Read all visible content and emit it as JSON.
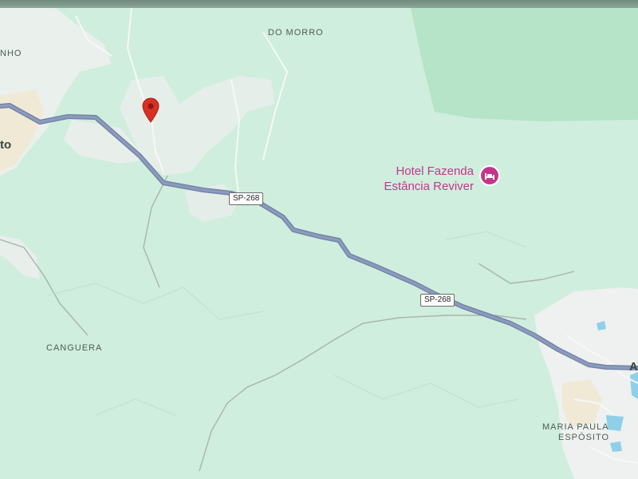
{
  "map": {
    "places": {
      "do_morro": "DO MORRO",
      "nho": "NHO",
      "canguera": "CANGUERA",
      "maria_paula_line1": "MARIA PAULA",
      "maria_paula_line2": "ESPÓSITO",
      "left_city_fragment": "to",
      "right_city_fragment": "A"
    },
    "roads": {
      "shield_1": "SP-268",
      "shield_2": "SP-268"
    },
    "poi": {
      "name_line1": "Hotel Fazenda",
      "name_line2": "Estância Reviver",
      "icon": "bed-icon",
      "color": "#c2378b"
    },
    "marker": {
      "icon": "location-pin-icon",
      "color": "#d93025"
    },
    "colors": {
      "land": "#cfeedd",
      "forest": "#b3e3c6",
      "urban": "#eef1ef",
      "route": "#8393b3",
      "water": "#8fd0e8"
    }
  }
}
